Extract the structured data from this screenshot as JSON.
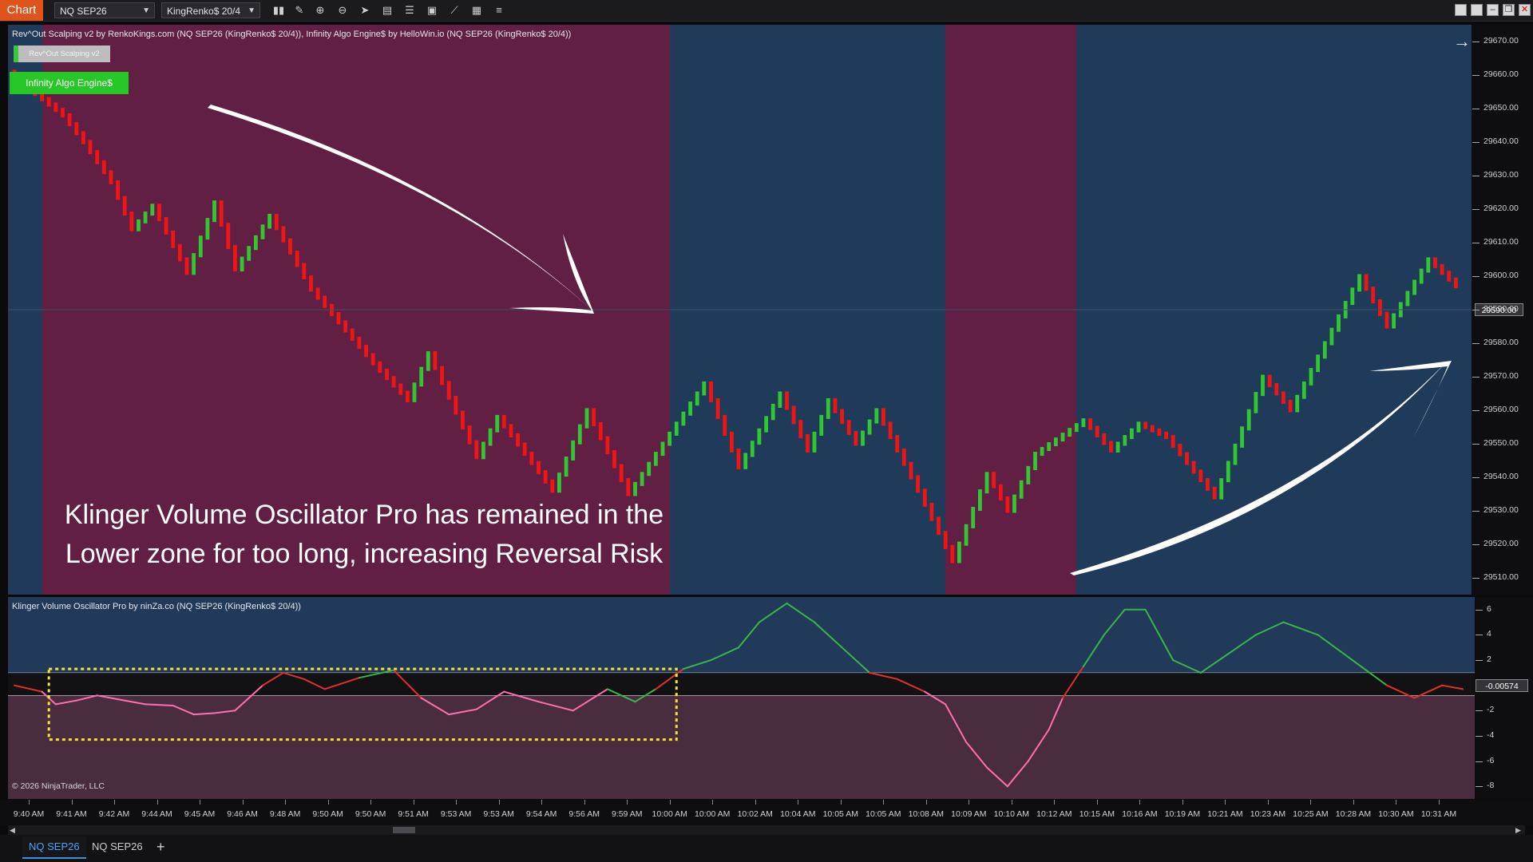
{
  "toolbar": {
    "app_label": "Chart",
    "instrument": "NQ SEP26",
    "bar_type": "KingRenko$ 20/4",
    "icons": [
      "bar-chart-icon",
      "pencil-icon",
      "zoom-in-icon",
      "zoom-out-icon",
      "cursor-icon",
      "data-box-icon",
      "properties-icon",
      "screenshot-icon",
      "strategies-icon",
      "templates-icon",
      "list-icon"
    ]
  },
  "price_panel": {
    "header": "Rev^Out Scalping v2 by RenkoKings.com (NQ SEP26 (KingRenko$ 20/4)), Infinity Algo Engine$ by HelloWin.io (NQ SEP26 (KingRenko$ 20/4))",
    "btn_revout": "Rev^Out Scalping v2",
    "btn_infinity": "Infinity Algo Engine$",
    "annotation_line1": "Klinger Volume Oscillator Pro has remained in the",
    "annotation_line2": "Lower zone for too long, increasing Reversal Risk",
    "last_price": "29590.00",
    "colors": {
      "bear_zone": "#611f44",
      "bull_zone": "#203a5a",
      "up_bar": "#33c633",
      "down_bar": "#f01414"
    }
  },
  "price_axis": {
    "labels": [
      "29670.00",
      "29660.00",
      "29650.00",
      "29640.00",
      "29630.00",
      "29620.00",
      "29610.00",
      "29600.00",
      "29590.00",
      "29580.00",
      "29570.00",
      "29560.00",
      "29550.00",
      "29540.00",
      "29530.00",
      "29520.00",
      "29510.00"
    ]
  },
  "osc_panel": {
    "header": "Klinger Volume Oscillator Pro by ninZa.co (NQ SEP26 (KingRenko$ 20/4))",
    "copyright": "© 2026 NinjaTrader, LLC",
    "last_value": "-0.00574",
    "axis_labels": [
      "6",
      "4",
      "2",
      "-2",
      "-4",
      "-6",
      "-8"
    ]
  },
  "time_axis": {
    "labels": [
      "9:40 AM",
      "9:41 AM",
      "9:42 AM",
      "9:44 AM",
      "9:45 AM",
      "9:46 AM",
      "9:48 AM",
      "9:50 AM",
      "9:50 AM",
      "9:51 AM",
      "9:53 AM",
      "9:53 AM",
      "9:54 AM",
      "9:56 AM",
      "9:59 AM",
      "10:00 AM",
      "10:00 AM",
      "10:02 AM",
      "10:04 AM",
      "10:05 AM",
      "10:05 AM",
      "10:08 AM",
      "10:09 AM",
      "10:10 AM",
      "10:12 AM",
      "10:15 AM",
      "10:16 AM",
      "10:19 AM",
      "10:21 AM",
      "10:23 AM",
      "10:25 AM",
      "10:28 AM",
      "10:30 AM",
      "10:31 AM"
    ]
  },
  "tabs": [
    {
      "label": "NQ SEP26",
      "active": true
    },
    {
      "label": "NQ SEP26",
      "active": false
    }
  ],
  "add_tab_label": "+",
  "chart_data": {
    "type": "line",
    "price_line": {
      "points": [
        [
          0,
          29661
        ],
        [
          3,
          29656
        ],
        [
          8,
          29648
        ],
        [
          11,
          29640
        ],
        [
          15,
          29628
        ],
        [
          18,
          29614
        ],
        [
          21,
          29621
        ],
        [
          26,
          29601
        ],
        [
          30,
          29622
        ],
        [
          33,
          29602
        ],
        [
          38,
          29618
        ],
        [
          44,
          29596
        ],
        [
          53,
          29574
        ],
        [
          58,
          29563
        ],
        [
          61,
          29577
        ],
        [
          68,
          29546
        ],
        [
          71,
          29558
        ],
        [
          79,
          29536
        ],
        [
          84,
          29560
        ],
        [
          90,
          29535
        ],
        [
          101,
          29568
        ],
        [
          106,
          29543
        ],
        [
          112,
          29565
        ],
        [
          116,
          29548
        ],
        [
          119,
          29563
        ],
        [
          123,
          29550
        ],
        [
          126,
          29560
        ],
        [
          132,
          29536
        ],
        [
          137,
          29515
        ],
        [
          142,
          29541
        ],
        [
          145,
          29530
        ],
        [
          149,
          29547
        ],
        [
          156,
          29557
        ],
        [
          160,
          29548
        ],
        [
          164,
          29556
        ],
        [
          168,
          29552
        ],
        [
          175,
          29534
        ],
        [
          182,
          29570
        ],
        [
          186,
          29560
        ],
        [
          196,
          29600
        ],
        [
          200,
          29585
        ],
        [
          206,
          29605
        ],
        [
          210,
          29597
        ]
      ],
      "y_range": [
        29505,
        29675
      ],
      "last": 29590.0
    },
    "zones": [
      {
        "type": "bull",
        "start": 0,
        "end": 4
      },
      {
        "type": "bear",
        "start": 4,
        "end": 95
      },
      {
        "type": "bull",
        "start": 95,
        "end": 135
      },
      {
        "type": "bear",
        "start": 135,
        "end": 154
      },
      {
        "type": "bull",
        "start": 154,
        "end": 210
      }
    ],
    "oscillator": {
      "y_range": [
        -9,
        7
      ],
      "upper_level": 1.0,
      "lower_level": -0.8,
      "last": -0.00574,
      "points": [
        [
          0,
          0.0
        ],
        [
          4,
          -0.5
        ],
        [
          6,
          -1.5
        ],
        [
          9,
          -1.2
        ],
        [
          12,
          -0.8
        ],
        [
          15,
          -1.1
        ],
        [
          19,
          -1.5
        ],
        [
          23,
          -1.6
        ],
        [
          26,
          -2.3
        ],
        [
          29,
          -2.2
        ],
        [
          32,
          -2.0
        ],
        [
          36,
          0.0
        ],
        [
          39,
          1.0
        ],
        [
          42,
          0.5
        ],
        [
          45,
          -0.3
        ],
        [
          50,
          0.6
        ],
        [
          55,
          1.2
        ],
        [
          59,
          -1.0
        ],
        [
          63,
          -2.3
        ],
        [
          67,
          -1.9
        ],
        [
          71,
          -0.5
        ],
        [
          76,
          -1.3
        ],
        [
          81,
          -2.0
        ],
        [
          86,
          -0.3
        ],
        [
          90,
          -1.3
        ],
        [
          93,
          -0.3
        ],
        [
          97,
          1.3
        ],
        [
          101,
          2.0
        ],
        [
          105,
          3.0
        ],
        [
          108,
          5.0
        ],
        [
          112,
          6.5
        ],
        [
          116,
          5.0
        ],
        [
          120,
          3.0
        ],
        [
          124,
          1.0
        ],
        [
          128,
          0.5
        ],
        [
          132,
          -0.5
        ],
        [
          135,
          -1.5
        ],
        [
          138,
          -4.5
        ],
        [
          141,
          -6.5
        ],
        [
          144,
          -8.0
        ],
        [
          147,
          -6.0
        ],
        [
          150,
          -3.5
        ],
        [
          152,
          -1.0
        ],
        [
          155,
          1.5
        ],
        [
          158,
          4.0
        ],
        [
          161,
          6.0
        ],
        [
          164,
          6.0
        ],
        [
          168,
          2.0
        ],
        [
          172,
          1.0
        ],
        [
          176,
          2.5
        ],
        [
          180,
          4.0
        ],
        [
          184,
          5.0
        ],
        [
          189,
          4.0
        ],
        [
          194,
          2.0
        ],
        [
          199,
          0.0
        ],
        [
          203,
          -1.0
        ],
        [
          207,
          0.0
        ],
        [
          210,
          -0.3
        ]
      ],
      "highlight_box": {
        "x_start": 5,
        "x_end": 96,
        "y_top": 1.3,
        "y_bottom": -4.3
      }
    }
  }
}
